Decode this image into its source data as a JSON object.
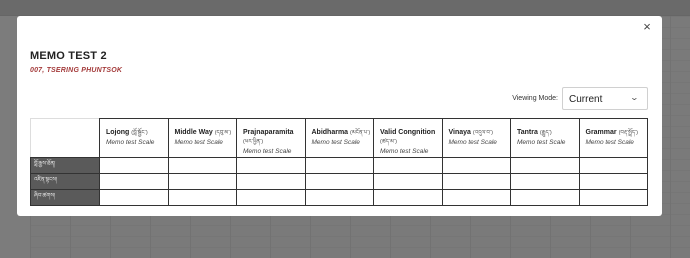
{
  "modal": {
    "title": "MEMO TEST 2",
    "subtitle": "007, TSERING PHUNTSOK",
    "close_label": "×",
    "viewing_mode": {
      "label": "Viewing Mode:",
      "value": "Current",
      "chevron": "⌄"
    }
  },
  "table": {
    "columns": [
      {
        "name": "Lojong",
        "tibetan": "(བློ་སྦྱོང་)",
        "scale": "Memo test Scale"
      },
      {
        "name": "Middle Way",
        "tibetan": "(དབུ་མ་)",
        "scale": "Memo test Scale"
      },
      {
        "name": "Prajnaparamita",
        "tibetan": "(ཕར་ཕྱིན་)",
        "scale": "Memo test Scale"
      },
      {
        "name": "Abidharma",
        "tibetan": "(མངོན་པ་)",
        "scale": "Memo test Scale"
      },
      {
        "name": "Valid Congnition",
        "tibetan": "(ཚད་མ་)",
        "scale": "Memo test Scale"
      },
      {
        "name": "Vinaya",
        "tibetan": "(འདུལ་བ་)",
        "scale": "Memo test Scale"
      },
      {
        "name": "Tantra",
        "tibetan": "(རྒྱུད་)",
        "scale": "Memo test Scale"
      },
      {
        "name": "Grammar",
        "tibetan": "(བརྡ་སྤྲོད་)",
        "scale": "Memo test Scale"
      }
    ],
    "rows": [
      {
        "label": "བློ་རྒྱས་ཐོན།"
      },
      {
        "label": "འཛིན་སྟངས།"
      },
      {
        "label": "ཞིབ་ཚགས།"
      }
    ]
  }
}
